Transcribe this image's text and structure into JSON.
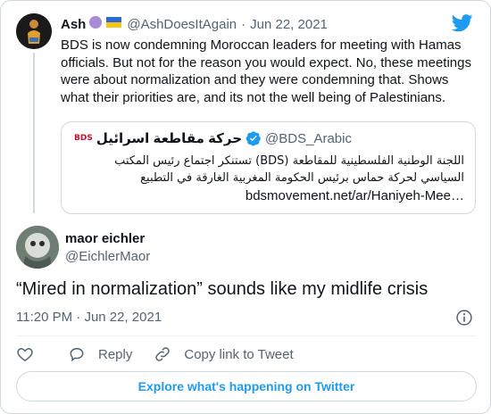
{
  "colors": {
    "twitter_blue": "#1d9bf0",
    "text_primary": "#0f1419",
    "text_secondary": "#536471",
    "border": "#cfd9de",
    "like_heart": "#536471",
    "bds_red": "#c8102e"
  },
  "parent_tweet": {
    "author_name": "Ash",
    "author_emojis": "🟣🇺🇦",
    "author_handle": "@AshDoesItAgain",
    "separator": "·",
    "date": "Jun 22, 2021",
    "text": "BDS is now condemning Moroccan leaders for meeting with Hamas officials. But not for the reason you would expect. No, these meetings were about normalization and they were condemning that. Shows what their priorities are, and its not the well being of Palestinians.",
    "quoted": {
      "logo_text": "BDS",
      "name": "حركة مقاطعة اسرائيل",
      "verified_icon": "verified-badge-icon",
      "handle": "@BDS_Arabic",
      "text": "اللجنة الوطنية الفلسطينية للمقاطعة (BDS) تستنكر اجتماع رئيس المكتب السياسي لحركة حماس برئيس الحكومة المغربية الغارقة في التطبيع",
      "link": "bdsmovement.net/ar/Haniyeh-Mee…"
    }
  },
  "main_tweet": {
    "author_name": "maor eichler",
    "author_handle": "@EichlerMaor",
    "text": "“Mired in normalization” sounds like my midlife crisis",
    "time": "11:20 PM",
    "separator": "·",
    "date": "Jun 22, 2021"
  },
  "actions": {
    "like_icon": "heart-icon",
    "reply_label": "Reply",
    "copy_link_label": "Copy link to Tweet"
  },
  "explore_button": "Explore what's happening on Twitter"
}
